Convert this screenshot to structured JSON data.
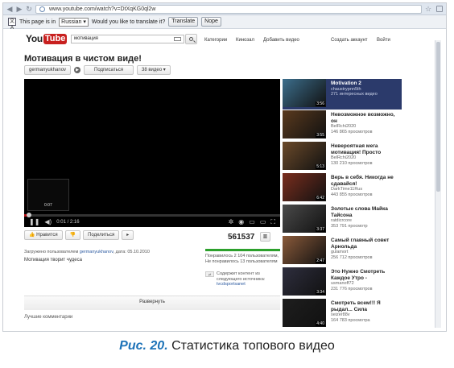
{
  "browser": {
    "url": "www.youtube.com/watch?v=DtXqKG0ql2w",
    "translate": {
      "prefix": "This page is in",
      "language": "Russian",
      "question": "Would you like to translate it?",
      "translate_label": "Translate",
      "nope_label": "Nope"
    }
  },
  "header": {
    "logo_you": "You",
    "logo_tube": "Tube",
    "search_value": "мотивация",
    "nav": [
      "Категории",
      "Кинозал",
      "Добавить видео"
    ],
    "account": [
      "Создать аккаунт",
      "Войти"
    ]
  },
  "video": {
    "title": "Мотивация в чистом виде!",
    "channel": "germanyukhanov",
    "subscribe": "Подписаться",
    "videos_count": "38 видео",
    "preview_time": "0:07",
    "current_time": "0:01 / 2:16",
    "progress_fraction": 0.02,
    "like_label": "Нравится",
    "share_label": "Поделиться",
    "views": "561537",
    "uploaded_prefix": "Загружено пользователем",
    "uploaded_user": "germanyukhanov",
    "uploaded_date": ", дата: 05.10.2010",
    "description": "Мотивация творит чудеса",
    "likes_text": "Понравилось 2 104 пользователям, Не понравилось 13 пользователям",
    "rights_text": "Содержит контент из следующего источника:",
    "rights_link": "tvcdsportsanet",
    "expand_label": "Развернуть",
    "comments_label": "Лучшие комментарии"
  },
  "related": [
    {
      "title": "Motivation 2",
      "author": "chaustrypnn5th",
      "views": "271 интересных видео",
      "duration": "3:56",
      "selected": true
    },
    {
      "title": "Невозможное возможно, он",
      "author": "BelRchi2020",
      "views": "146 865 просмотров",
      "duration": "3:55"
    },
    {
      "title": "Невероятная мега мотивация! Просто",
      "author": "BelRchi2020",
      "views": "130 210 просмотров",
      "duration": "5:13"
    },
    {
      "title": "Верь в себя. Никогда не сдавайся!",
      "author": "DarkTime11Rus",
      "views": "443 855 просмотров",
      "duration": "6:42"
    },
    {
      "title": "Золотые слова Майка Тайсона",
      "author": "ratdicrcore",
      "views": "353 791 просмотр",
      "duration": "3:37"
    },
    {
      "title": "Самый главный совет Арнольда",
      "author": "gulamort",
      "views": "256 712 просмотров",
      "duration": "2:47"
    },
    {
      "title": "Это Нужно Смотреть Каждое Утро -",
      "author": "usmanoff72",
      "views": "231 776 просмотров",
      "duration": "3:34"
    },
    {
      "title": "Смотреть всем!!! Я рыдал... Сила",
      "author": "seizer88v",
      "views": "164 783 просмотра",
      "duration": "4:40"
    }
  ],
  "caption": {
    "label": "Рис. 20.",
    "text": "Статистика топового видео"
  }
}
